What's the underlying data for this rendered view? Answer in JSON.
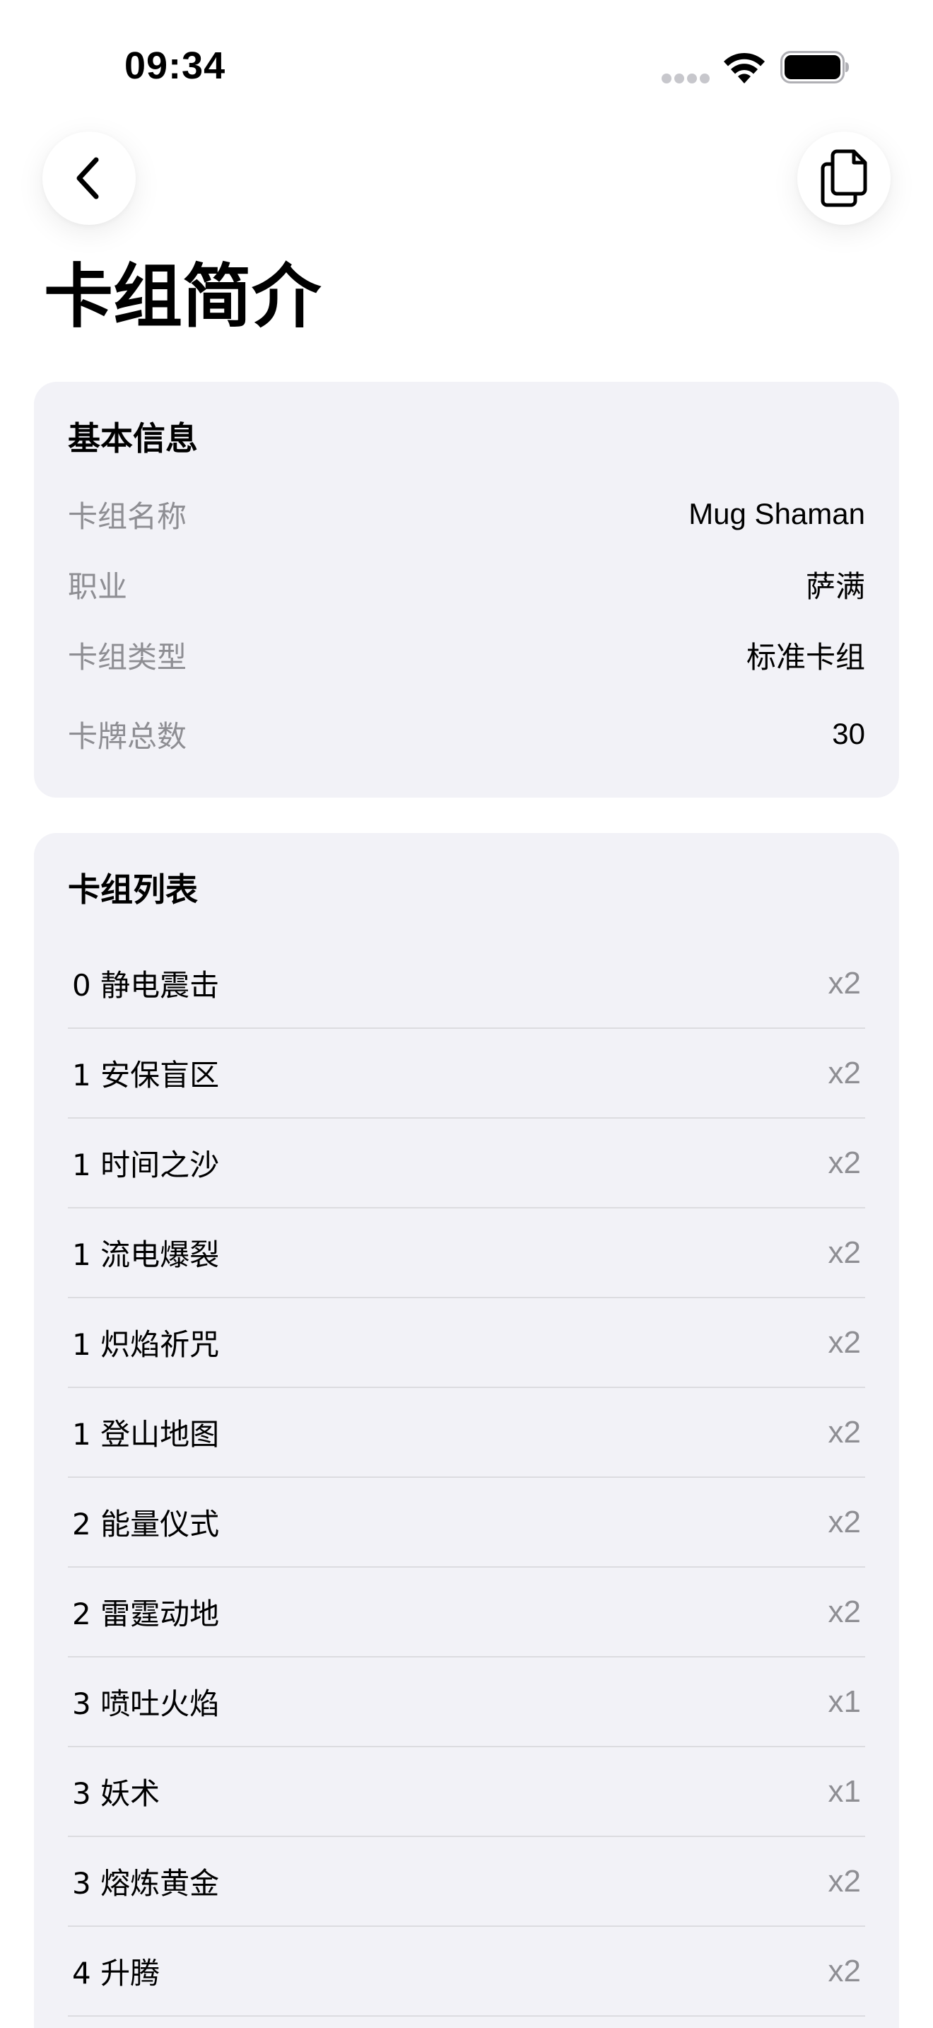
{
  "status_bar": {
    "time": "09:34"
  },
  "nav": {
    "back_icon": "chevron-left-icon",
    "copy_icon": "copy-icon"
  },
  "page": {
    "title": "卡组简介"
  },
  "basic_info": {
    "title": "基本信息",
    "rows": [
      {
        "label": "卡组名称",
        "value": "Mug Shaman"
      },
      {
        "label": "职业",
        "value": "萨满"
      },
      {
        "label": "卡组类型",
        "value": "标准卡组"
      },
      {
        "label": "卡牌总数",
        "value": "30"
      }
    ]
  },
  "deck_list": {
    "title": "卡组列表",
    "cards": [
      {
        "name": "0 静电震击",
        "count": "x2"
      },
      {
        "name": "1 安保盲区",
        "count": "x2"
      },
      {
        "name": "1 时间之沙",
        "count": "x2"
      },
      {
        "name": "1 流电爆裂",
        "count": "x2"
      },
      {
        "name": "1 炽焰祈咒",
        "count": "x2"
      },
      {
        "name": "1 登山地图",
        "count": "x2"
      },
      {
        "name": "2 能量仪式",
        "count": "x2"
      },
      {
        "name": "2 雷霆动地",
        "count": "x2"
      },
      {
        "name": "3 喷吐火焰",
        "count": "x1"
      },
      {
        "name": "3 妖术",
        "count": "x1"
      },
      {
        "name": "3 熔炼黄金",
        "count": "x2"
      },
      {
        "name": "4 升腾",
        "count": "x2"
      }
    ]
  },
  "colors": {
    "card_background": "#f2f2f7",
    "secondary_text": "#8e8e93",
    "separator": "#dcdce0"
  }
}
